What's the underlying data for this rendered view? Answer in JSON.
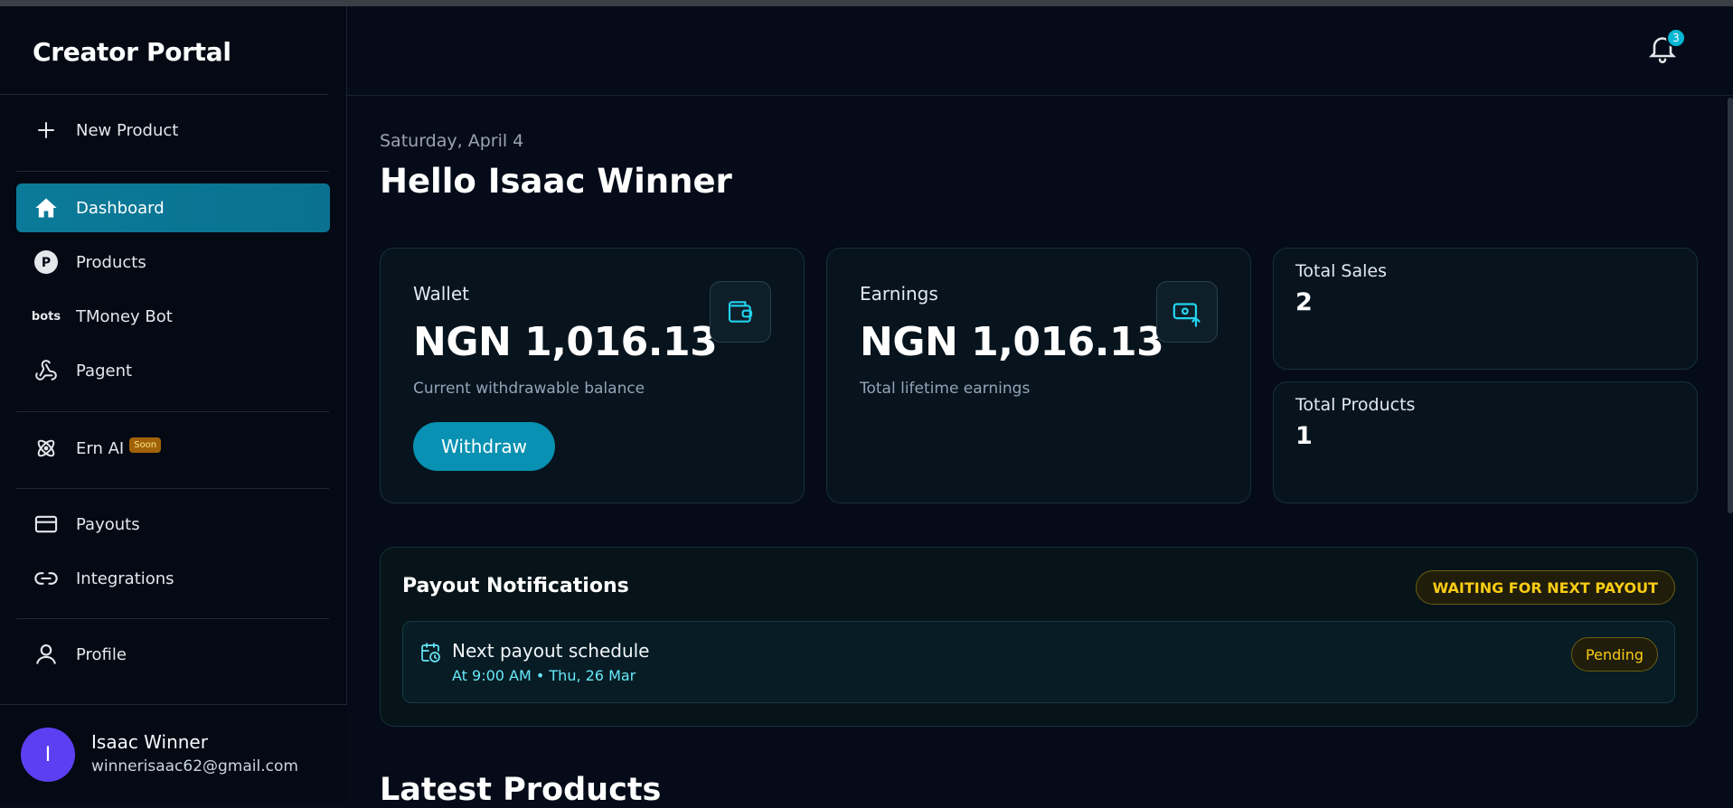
{
  "sidebar": {
    "brand": "Creator Portal",
    "items": [
      {
        "label": "New Product",
        "icon": "plus-icon"
      },
      {
        "label": "Dashboard",
        "icon": "home-icon"
      },
      {
        "label": "Products",
        "icon": "products-icon"
      },
      {
        "label": "TMoney Bot",
        "icon": "bots-icon",
        "icon_text": "bots"
      },
      {
        "label": "Pagent",
        "icon": "webhook-icon"
      },
      {
        "label": "Ern AI",
        "icon": "atom-icon",
        "badge": "Soon"
      },
      {
        "label": "Payouts",
        "icon": "card-icon"
      },
      {
        "label": "Integrations",
        "icon": "link-icon"
      },
      {
        "label": "Profile",
        "icon": "user-icon"
      }
    ],
    "user": {
      "initial": "I",
      "name": "Isaac Winner",
      "email": "winnerisaac62@gmail.com"
    }
  },
  "header": {
    "notification_count": "3"
  },
  "main": {
    "date": "Saturday, April 4",
    "greeting": "Hello Isaac Winner",
    "wallet": {
      "label": "Wallet",
      "value": "NGN 1,016.13",
      "sub": "Current withdrawable balance",
      "button": "Withdraw"
    },
    "earnings": {
      "label": "Earnings",
      "value": "NGN 1,016.13",
      "sub": "Total lifetime earnings"
    },
    "total_sales": {
      "label": "Total Sales",
      "value": "2"
    },
    "total_products": {
      "label": "Total Products",
      "value": "1"
    },
    "payouts": {
      "title": "Payout Notifications",
      "status": "WAITING FOR NEXT PAYOUT",
      "schedule_title": "Next payout schedule",
      "schedule_sub": "At 9:00 AM • Thu, 26 Mar",
      "schedule_status": "Pending"
    },
    "latest_title": "Latest Products"
  },
  "colors": {
    "accent": "#0891b2",
    "active_nav": "#0b7a99",
    "warning": "#facc15",
    "avatar": "#5b3ff0"
  }
}
